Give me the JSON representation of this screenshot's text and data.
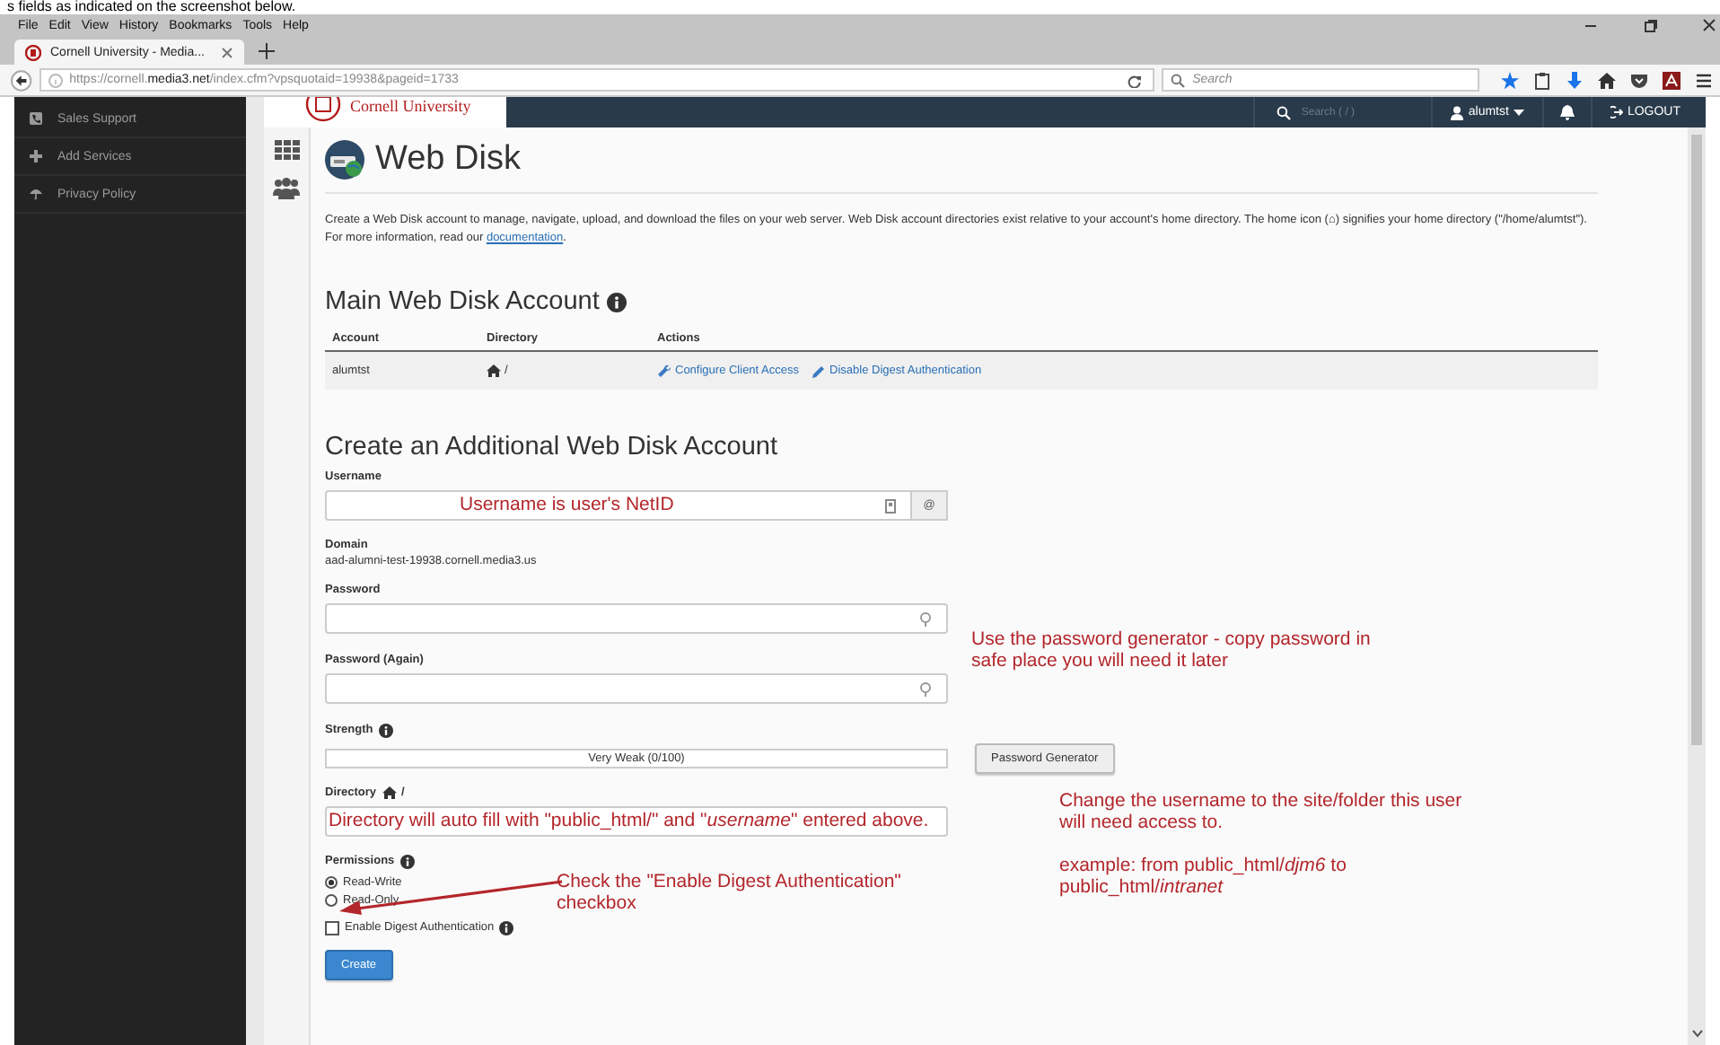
{
  "doc_caption": "s fields as indicated on the screenshot below.",
  "browser": {
    "menu": [
      "File",
      "Edit",
      "View",
      "History",
      "Bookmarks",
      "Tools",
      "Help"
    ],
    "tabs": [
      {
        "title": "Cornell University - Media...",
        "selected": true
      }
    ],
    "url": {
      "scheme": "https://cornell.",
      "domain": "media3.net",
      "path": "/index.cfm?vpsquotaid=19938&pageid=1733"
    },
    "search_placeholder": "Search"
  },
  "sidebar": {
    "items": [
      {
        "label": "Sales Support"
      },
      {
        "label": "Add Services"
      },
      {
        "label": "Privacy Policy"
      }
    ]
  },
  "topbar": {
    "logo_text": "Cornell University",
    "search_placeholder": "Search ( / )",
    "user": "alumtst",
    "logout": "LOGOUT"
  },
  "page": {
    "title": "Web Disk",
    "intro": "Create a Web Disk account to manage, navigate, upload, and download the files on your web server. Web Disk account directories exist relative to your account's home directory. The home icon (⌂) signifies your home directory (\"/home/alumtst\"). For more information, read our ",
    "intro_link": "documentation",
    "intro_end": "."
  },
  "main_account": {
    "title": "Main Web Disk Account",
    "columns": [
      "Account",
      "Directory",
      "Actions"
    ],
    "rows": [
      {
        "account": "alumtst",
        "directory": "/",
        "actions": [
          {
            "label": "Configure Client Access"
          },
          {
            "label": "Disable Digest Authentication"
          }
        ]
      }
    ]
  },
  "create": {
    "title": "Create an Additional Web Disk Account",
    "username_label": "Username",
    "username_addon": "@",
    "domain_label": "Domain",
    "domain": "aad-alumni-test-19938.cornell.media3.us",
    "password_label": "Password",
    "password_again_label": "Password (Again)",
    "strength_label": "Strength",
    "strength": {
      "level": 0,
      "text": "Very Weak (0/100)"
    },
    "generator_button": "Password Generator",
    "directory_label": "Directory",
    "directory_suffix": "/",
    "permissions_label": "Permissions",
    "permissions": [
      {
        "label": "Read-Write",
        "selected": true
      },
      {
        "label": "Read-Only",
        "selected": false
      }
    ],
    "digest": {
      "label": "Enable Digest Authentication",
      "checked": false
    },
    "create_button": "Create"
  },
  "annotations": [
    {
      "kind": "username",
      "paragraphs": [
        "Username is user's NetID"
      ]
    },
    {
      "kind": "password",
      "paragraphs": [
        "Use the password generator - copy password in  safe place you will need it later"
      ]
    },
    {
      "kind": "directory",
      "paragraphs": [
        "Directory will auto fill with \"public_html/\" and \"*username*\" entered above."
      ]
    },
    {
      "kind": "change",
      "paragraphs": [
        "Change the username to the site/folder this user will need access to.",
        "example: from public_html/*djm6* to public_html/*intranet*"
      ]
    },
    {
      "kind": "digest",
      "paragraphs": [
        "Check the \"Enable Digest Authentication\" checkbox"
      ]
    }
  ]
}
